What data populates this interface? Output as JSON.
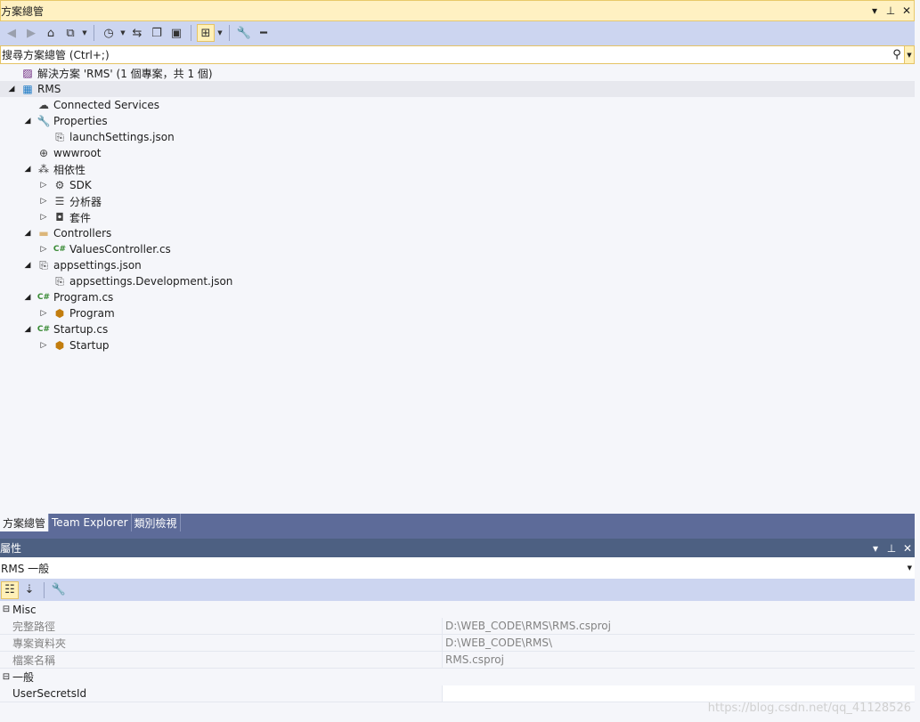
{
  "solution_explorer": {
    "title": "方案總管",
    "controls": {
      "menu": "▾",
      "pin": "⊥",
      "close": "✕"
    },
    "toolbar_icons": [
      "back-icon",
      "forward-icon",
      "home-icon",
      "switch-views-icon",
      "pending-changes-icon",
      "sync-icon",
      "collapse-all-icon",
      "show-all-files-icon",
      "preview-selected-icon",
      "properties-icon",
      "minus-icon"
    ],
    "search_placeholder": "搜尋方案總管 (Ctrl+;)",
    "tree": [
      {
        "label": "解決方案 'RMS' (1 個專案，共 1 個)",
        "level": 0,
        "arrow": "",
        "icon": "solution-icon"
      },
      {
        "label": "RMS",
        "level": 0,
        "arrow": "◢",
        "icon": "project-icon",
        "selected": true
      },
      {
        "label": "Connected Services",
        "level": 1,
        "arrow": "",
        "icon": "cloud-icon"
      },
      {
        "label": "Properties",
        "level": 1,
        "arrow": "◢",
        "icon": "wrench-icon"
      },
      {
        "label": "launchSettings.json",
        "level": 2,
        "arrow": "",
        "icon": "json-icon"
      },
      {
        "label": "wwwroot",
        "level": 1,
        "arrow": "",
        "icon": "globe-icon"
      },
      {
        "label": "相依性",
        "level": 1,
        "arrow": "◢",
        "icon": "dependencies-icon"
      },
      {
        "label": "SDK",
        "level": 2,
        "arrow": "▷",
        "icon": "sdk-icon"
      },
      {
        "label": "分析器",
        "level": 2,
        "arrow": "▷",
        "icon": "analyzer-icon"
      },
      {
        "label": "套件",
        "level": 2,
        "arrow": "▷",
        "icon": "package-icon"
      },
      {
        "label": "Controllers",
        "level": 1,
        "arrow": "◢",
        "icon": "folder-icon"
      },
      {
        "label": "ValuesController.cs",
        "level": 2,
        "arrow": "▷",
        "icon": "csharp-icon"
      },
      {
        "label": "appsettings.json",
        "level": 1,
        "arrow": "◢",
        "icon": "json-icon"
      },
      {
        "label": "appsettings.Development.json",
        "level": 2,
        "arrow": "",
        "icon": "json-icon"
      },
      {
        "label": "Program.cs",
        "level": 1,
        "arrow": "◢",
        "icon": "csharp-icon"
      },
      {
        "label": "Program",
        "level": 2,
        "arrow": "▷",
        "icon": "class-icon"
      },
      {
        "label": "Startup.cs",
        "level": 1,
        "arrow": "◢",
        "icon": "csharp-icon"
      },
      {
        "label": "Startup",
        "level": 2,
        "arrow": "▷",
        "icon": "class-icon"
      }
    ],
    "bottom_tabs": [
      {
        "label": "方案總管",
        "active": true
      },
      {
        "label": "Team Explorer",
        "active": false
      },
      {
        "label": "類別檢視",
        "active": false
      }
    ]
  },
  "properties": {
    "title": "屬性",
    "controls": {
      "menu": "▾",
      "pin": "⊥",
      "close": "✕"
    },
    "object_selector": "RMS  一般",
    "categories": [
      {
        "name": "Misc",
        "rows": [
          {
            "name": "完整路徑",
            "value": "D:\\WEB_CODE\\RMS\\RMS.csproj"
          },
          {
            "name": "專案資料夾",
            "value": "D:\\WEB_CODE\\RMS\\"
          },
          {
            "name": "檔案名稱",
            "value": "RMS.csproj"
          }
        ]
      },
      {
        "name": "一般",
        "rows": [
          {
            "name": "UserSecretsId",
            "value": "",
            "editable": true
          }
        ]
      }
    ]
  },
  "watermark": "https://blog.csdn.net/qq_41128526",
  "colors": {
    "active_title": "#fff1c2",
    "toolbar": "#ccd5f0",
    "inactive_title": "#4d6082",
    "tab_strip": "#5d6b99",
    "background": "#f5f6fa"
  }
}
